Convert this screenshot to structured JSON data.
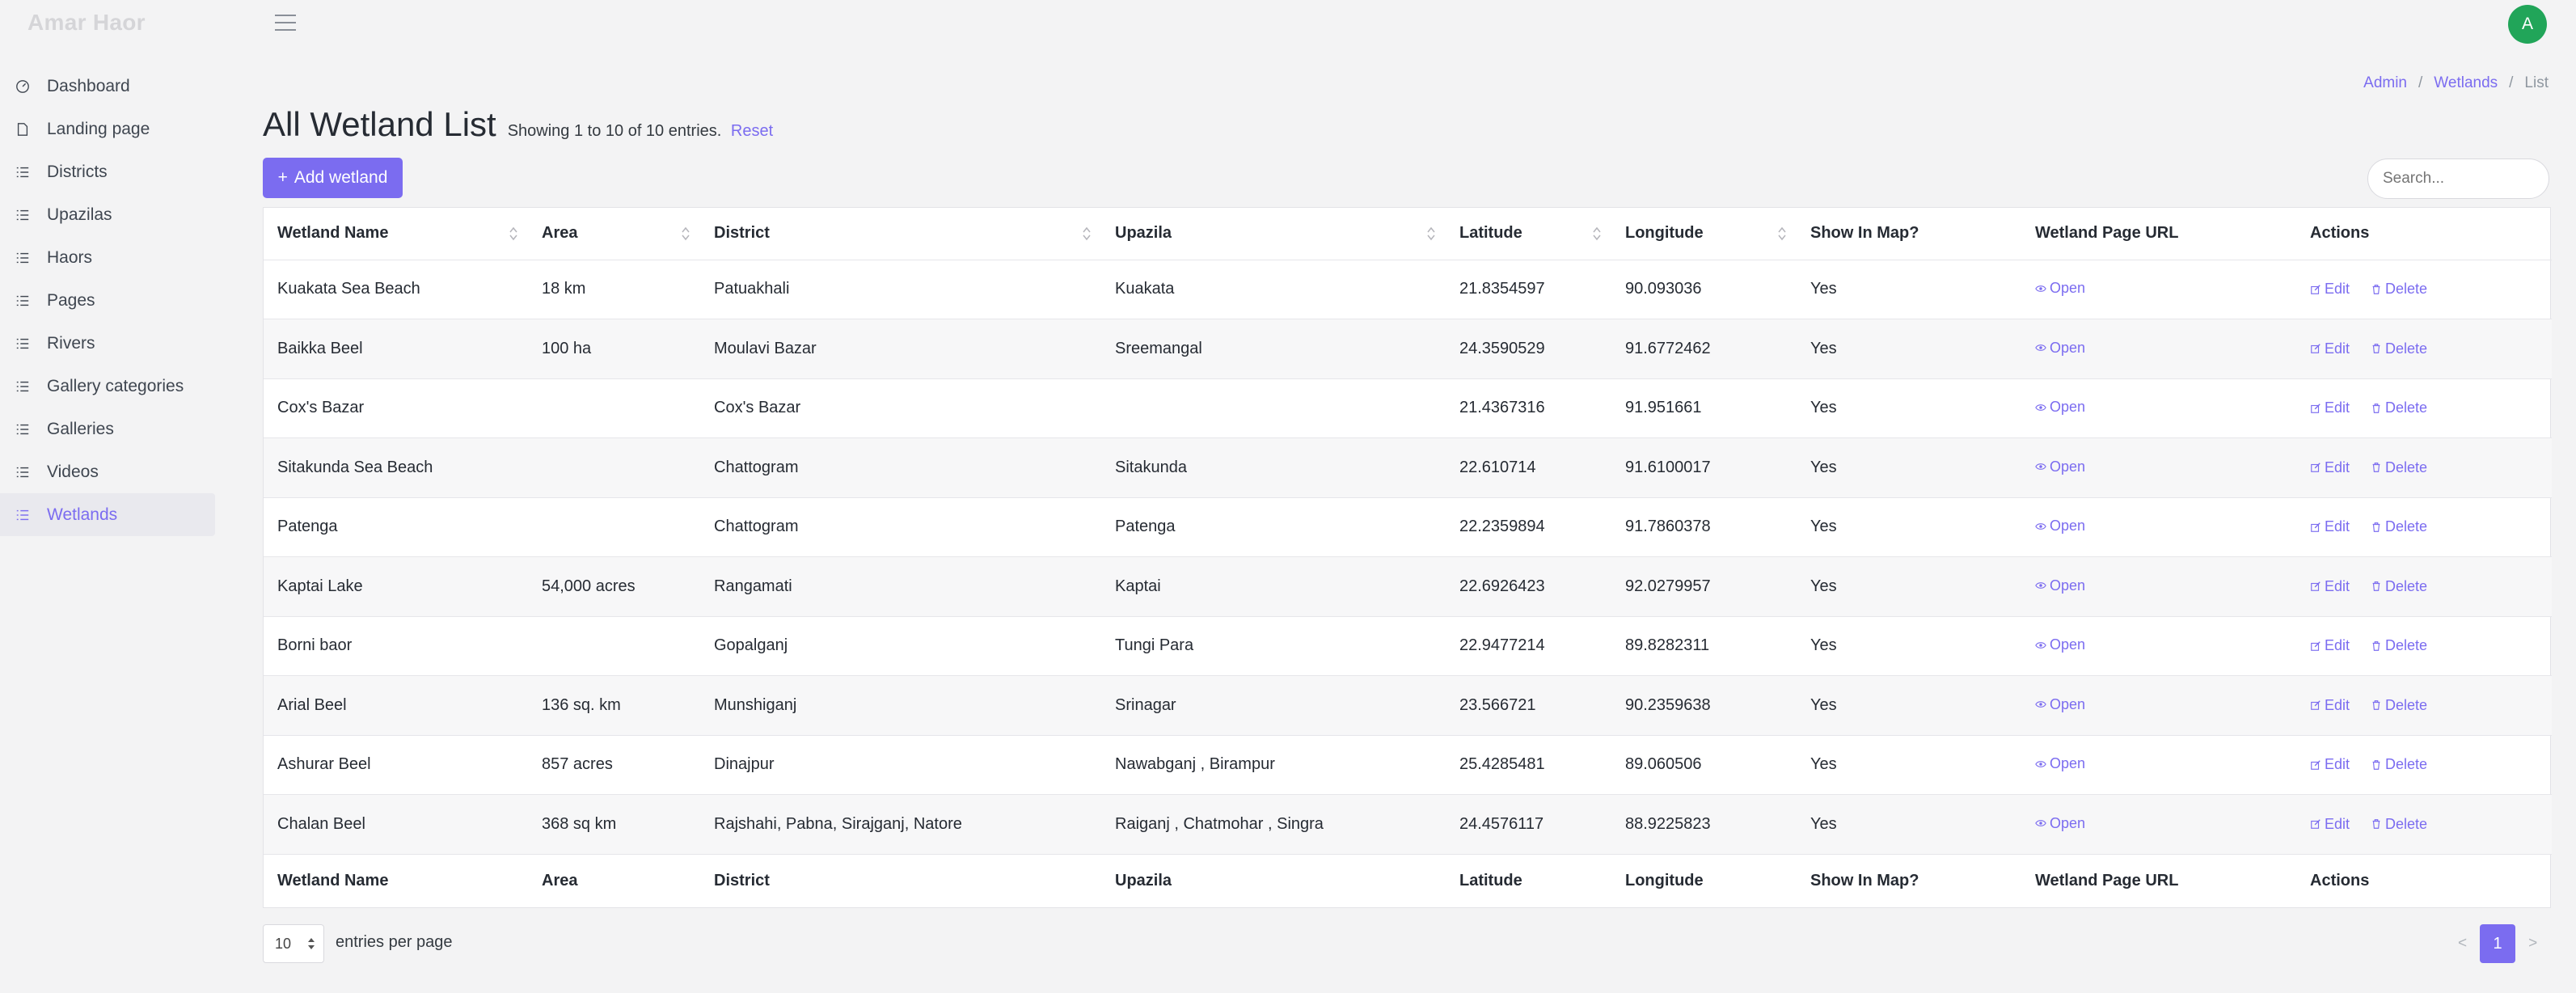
{
  "brand": "Amar Haor",
  "user": {
    "avatar_letter": "A"
  },
  "sidebar": {
    "items": [
      {
        "label": "Dashboard",
        "icon": "dashboard-icon"
      },
      {
        "label": "Landing page",
        "icon": "file-icon"
      },
      {
        "label": "Districts",
        "icon": "list-icon"
      },
      {
        "label": "Upazilas",
        "icon": "list-icon"
      },
      {
        "label": "Haors",
        "icon": "list-icon"
      },
      {
        "label": "Pages",
        "icon": "list-icon"
      },
      {
        "label": "Rivers",
        "icon": "list-icon"
      },
      {
        "label": "Gallery categories",
        "icon": "list-icon"
      },
      {
        "label": "Galleries",
        "icon": "list-icon"
      },
      {
        "label": "Videos",
        "icon": "list-icon"
      },
      {
        "label": "Wetlands",
        "icon": "list-icon",
        "active": true
      }
    ]
  },
  "breadcrumb": {
    "root": "Admin",
    "section": "Wetlands",
    "current": "List",
    "separator": "/"
  },
  "page": {
    "title": "All Wetland List",
    "summary": "Showing 1 to 10 of 10 entries.",
    "reset": "Reset",
    "add_button": "Add wetland",
    "search_placeholder": "Search..."
  },
  "table": {
    "columns": [
      "Wetland Name",
      "Area",
      "District",
      "Upazila",
      "Latitude",
      "Longitude",
      "Show In Map?",
      "Wetland Page URL",
      "Actions"
    ],
    "open_label": "Open",
    "edit_label": "Edit",
    "delete_label": "Delete",
    "rows": [
      {
        "name": "Kuakata Sea Beach",
        "area": "18 km",
        "district": "Patuakhali",
        "upazila": "Kuakata",
        "lat": "21.8354597",
        "lng": "90.093036",
        "show": "Yes"
      },
      {
        "name": "Baikka Beel",
        "area": "100 ha",
        "district": "Moulavi Bazar",
        "upazila": "Sreemangal",
        "lat": "24.3590529",
        "lng": "91.6772462",
        "show": "Yes"
      },
      {
        "name": "Cox's Bazar",
        "area": "",
        "district": "Cox's Bazar",
        "upazila": "",
        "lat": "21.4367316",
        "lng": "91.951661",
        "show": "Yes"
      },
      {
        "name": "Sitakunda Sea Beach",
        "area": "",
        "district": "Chattogram",
        "upazila": "Sitakunda",
        "lat": "22.610714",
        "lng": "91.6100017",
        "show": "Yes"
      },
      {
        "name": "Patenga",
        "area": "",
        "district": "Chattogram",
        "upazila": "Patenga",
        "lat": "22.2359894",
        "lng": "91.7860378",
        "show": "Yes"
      },
      {
        "name": "Kaptai Lake",
        "area": "54,000 acres",
        "district": "Rangamati",
        "upazila": "Kaptai",
        "lat": "22.6926423",
        "lng": "92.0279957",
        "show": "Yes"
      },
      {
        "name": "Borni baor",
        "area": "",
        "district": "Gopalganj",
        "upazila": "Tungi Para",
        "lat": "22.9477214",
        "lng": "89.8282311",
        "show": "Yes"
      },
      {
        "name": "Arial Beel",
        "area": "136 sq. km",
        "district": "Munshiganj",
        "upazila": "Srinagar",
        "lat": "23.566721",
        "lng": "90.2359638",
        "show": "Yes"
      },
      {
        "name": "Ashurar Beel",
        "area": "857 acres",
        "district": "Dinajpur",
        "upazila": "Nawabganj , Birampur",
        "lat": "25.4285481",
        "lng": "89.060506",
        "show": "Yes"
      },
      {
        "name": "Chalan Beel",
        "area": "368 sq km",
        "district": "Rajshahi, Pabna, Sirajganj, Natore",
        "upazila": "Raiganj , Chatmohar , Singra",
        "lat": "24.4576117",
        "lng": "88.9225823",
        "show": "Yes"
      }
    ]
  },
  "footer": {
    "per_page_value": "10",
    "per_page_label": "entries per page",
    "prev": "<",
    "next": ">",
    "current_page": "1"
  },
  "colors": {
    "accent": "#7b6cf0",
    "avatar": "#21a559"
  }
}
